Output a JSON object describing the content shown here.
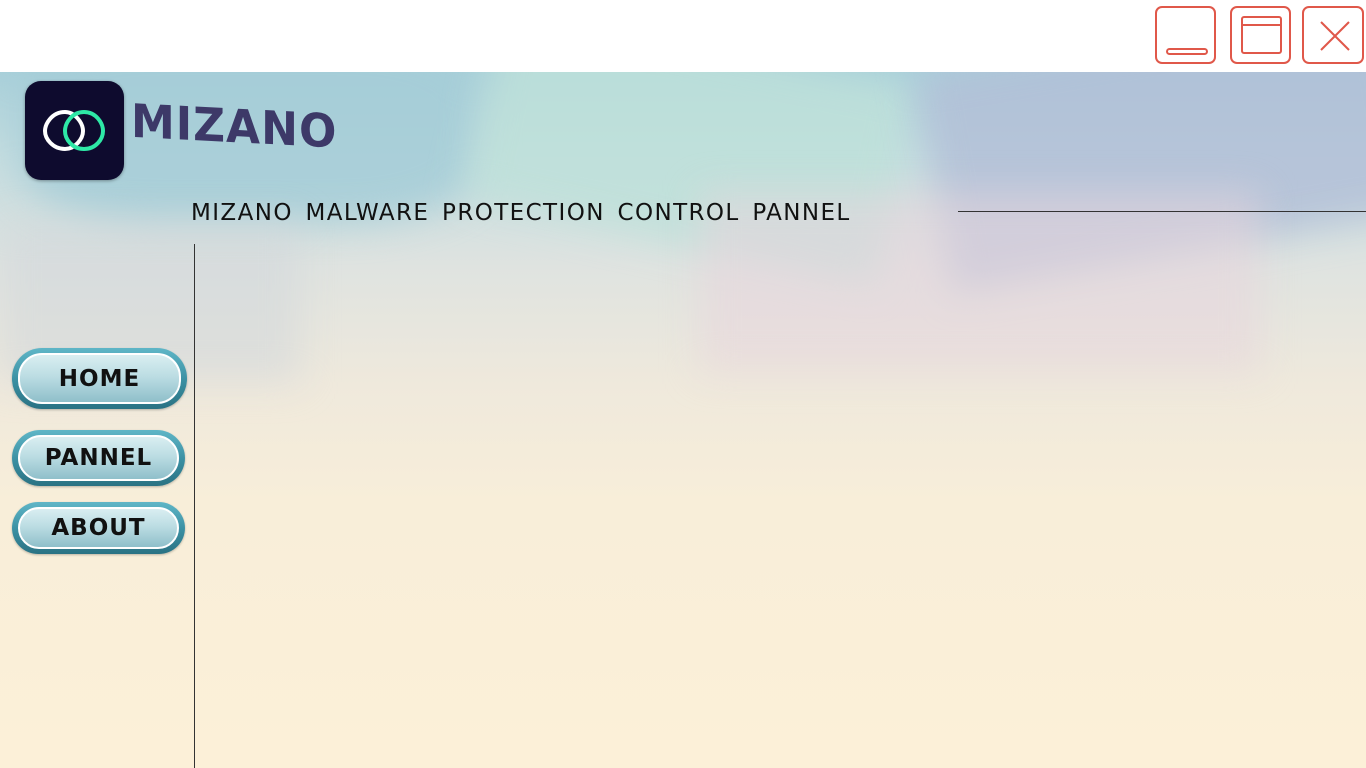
{
  "app": {
    "brand": "MIZANO",
    "title": "MIZANO MALWARE PROTECTION CONTROL PANNEL"
  },
  "window_controls": {
    "minimize_icon": "minimize-icon",
    "maximize_icon": "maximize-icon",
    "close_icon": "close-icon",
    "accent": "#e0584a"
  },
  "sidebar": {
    "items": [
      {
        "label": "HOME"
      },
      {
        "label": "PANNEL"
      },
      {
        "label": "ABOUT"
      }
    ]
  },
  "colors": {
    "logo_background": "#0e0b2e",
    "logo_ring_left": "#ffffff",
    "logo_ring_right": "#2ee8a6",
    "brand_text": "#3d3968",
    "nav_button": "#3a8ea1"
  }
}
